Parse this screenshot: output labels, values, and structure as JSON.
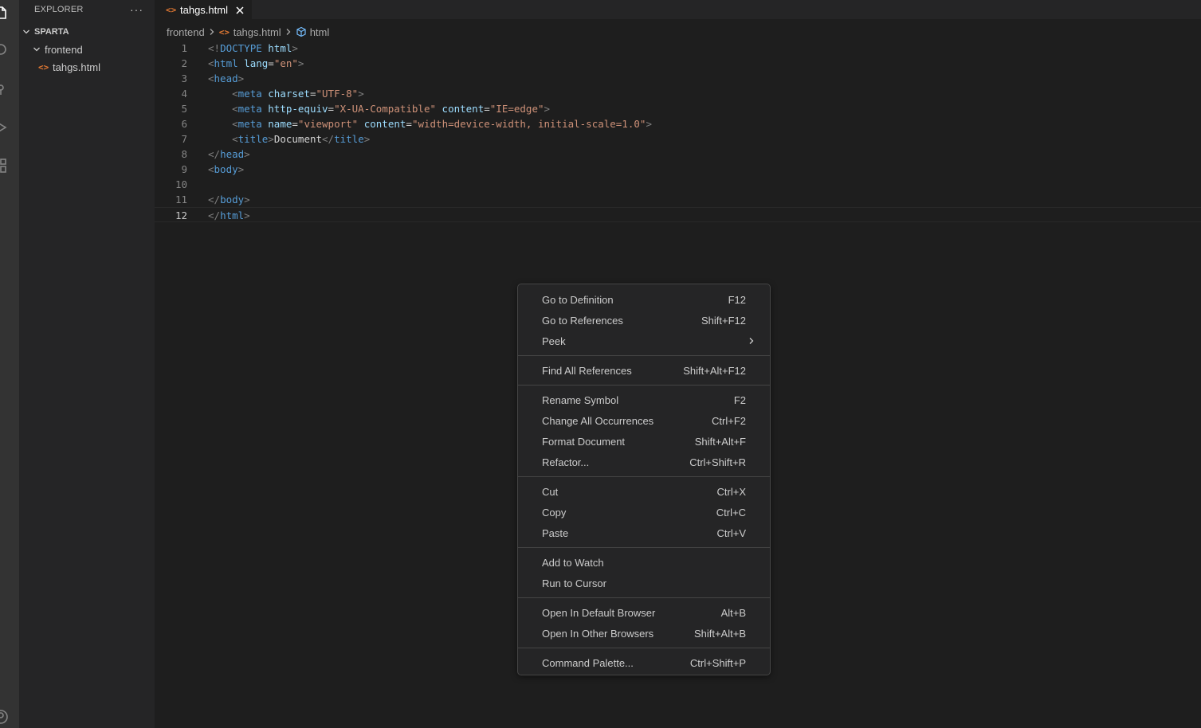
{
  "sidebar": {
    "title": "EXPLORER",
    "more": "···",
    "section": "SPARTA",
    "folder": "frontend",
    "file": "tahgs.html"
  },
  "editor": {
    "tab_label": "tahgs.html",
    "breadcrumb": [
      "frontend",
      "tahgs.html",
      "html"
    ]
  },
  "icons": {
    "file_code": "<>"
  },
  "code": {
    "line_numbers": [
      "1",
      "2",
      "3",
      "4",
      "5",
      "6",
      "7",
      "8",
      "9",
      "10",
      "11",
      "12"
    ],
    "lines": [
      [
        [
          "<!",
          "t-punc"
        ],
        [
          "DOCTYPE",
          "t-tag"
        ],
        [
          " ",
          "t-text"
        ],
        [
          "html",
          "t-attr"
        ],
        [
          ">",
          "t-punc"
        ]
      ],
      [
        [
          "<",
          "t-punc"
        ],
        [
          "html",
          "t-tag"
        ],
        [
          " ",
          "t-text"
        ],
        [
          "lang",
          "t-attr"
        ],
        [
          "=",
          "t-text"
        ],
        [
          "\"en\"",
          "t-str"
        ],
        [
          ">",
          "t-punc"
        ]
      ],
      [
        [
          "<",
          "t-punc"
        ],
        [
          "head",
          "t-tag"
        ],
        [
          ">",
          "t-punc"
        ]
      ],
      [
        [
          "    ",
          "t-text"
        ],
        [
          "<",
          "t-punc"
        ],
        [
          "meta",
          "t-tag"
        ],
        [
          " ",
          "t-text"
        ],
        [
          "charset",
          "t-attr"
        ],
        [
          "=",
          "t-text"
        ],
        [
          "\"UTF-8\"",
          "t-str"
        ],
        [
          ">",
          "t-punc"
        ]
      ],
      [
        [
          "    ",
          "t-text"
        ],
        [
          "<",
          "t-punc"
        ],
        [
          "meta",
          "t-tag"
        ],
        [
          " ",
          "t-text"
        ],
        [
          "http-equiv",
          "t-attr"
        ],
        [
          "=",
          "t-text"
        ],
        [
          "\"X-UA-Compatible\"",
          "t-str"
        ],
        [
          " ",
          "t-text"
        ],
        [
          "content",
          "t-attr"
        ],
        [
          "=",
          "t-text"
        ],
        [
          "\"IE=edge\"",
          "t-str"
        ],
        [
          ">",
          "t-punc"
        ]
      ],
      [
        [
          "    ",
          "t-text"
        ],
        [
          "<",
          "t-punc"
        ],
        [
          "meta",
          "t-tag"
        ],
        [
          " ",
          "t-text"
        ],
        [
          "name",
          "t-attr"
        ],
        [
          "=",
          "t-text"
        ],
        [
          "\"viewport\"",
          "t-str"
        ],
        [
          " ",
          "t-text"
        ],
        [
          "content",
          "t-attr"
        ],
        [
          "=",
          "t-text"
        ],
        [
          "\"width=device-width, initial-scale=1.0\"",
          "t-str"
        ],
        [
          ">",
          "t-punc"
        ]
      ],
      [
        [
          "    ",
          "t-text"
        ],
        [
          "<",
          "t-punc"
        ],
        [
          "title",
          "t-tag"
        ],
        [
          ">",
          "t-punc"
        ],
        [
          "Document",
          "t-text"
        ],
        [
          "</",
          "t-punc"
        ],
        [
          "title",
          "t-tag"
        ],
        [
          ">",
          "t-punc"
        ]
      ],
      [
        [
          "</",
          "t-punc"
        ],
        [
          "head",
          "t-tag"
        ],
        [
          ">",
          "t-punc"
        ]
      ],
      [
        [
          "<",
          "t-punc"
        ],
        [
          "body",
          "t-tag"
        ],
        [
          ">",
          "t-punc"
        ]
      ],
      [],
      [
        [
          "</",
          "t-punc"
        ],
        [
          "body",
          "t-tag"
        ],
        [
          ">",
          "t-punc"
        ]
      ],
      [
        [
          "</",
          "t-punc"
        ],
        [
          "html",
          "t-tag"
        ],
        [
          ">",
          "t-punc"
        ]
      ]
    ]
  },
  "context_menu": {
    "groups": [
      [
        {
          "label": "Go to Definition",
          "key": "F12"
        },
        {
          "label": "Go to References",
          "key": "Shift+F12"
        },
        {
          "label": "Peek",
          "key": "",
          "submenu": true
        }
      ],
      [
        {
          "label": "Find All References",
          "key": "Shift+Alt+F12"
        }
      ],
      [
        {
          "label": "Rename Symbol",
          "key": "F2"
        },
        {
          "label": "Change All Occurrences",
          "key": "Ctrl+F2"
        },
        {
          "label": "Format Document",
          "key": "Shift+Alt+F"
        },
        {
          "label": "Refactor...",
          "key": "Ctrl+Shift+R"
        }
      ],
      [
        {
          "label": "Cut",
          "key": "Ctrl+X"
        },
        {
          "label": "Copy",
          "key": "Ctrl+C"
        },
        {
          "label": "Paste",
          "key": "Ctrl+V"
        }
      ],
      [
        {
          "label": "Add to Watch",
          "key": ""
        },
        {
          "label": "Run to Cursor",
          "key": ""
        }
      ],
      [
        {
          "label": "Open In Default Browser",
          "key": "Alt+B"
        },
        {
          "label": "Open In Other Browsers",
          "key": "Shift+Alt+B"
        }
      ],
      [
        {
          "label": "Command Palette...",
          "key": "Ctrl+Shift+P"
        }
      ]
    ]
  }
}
